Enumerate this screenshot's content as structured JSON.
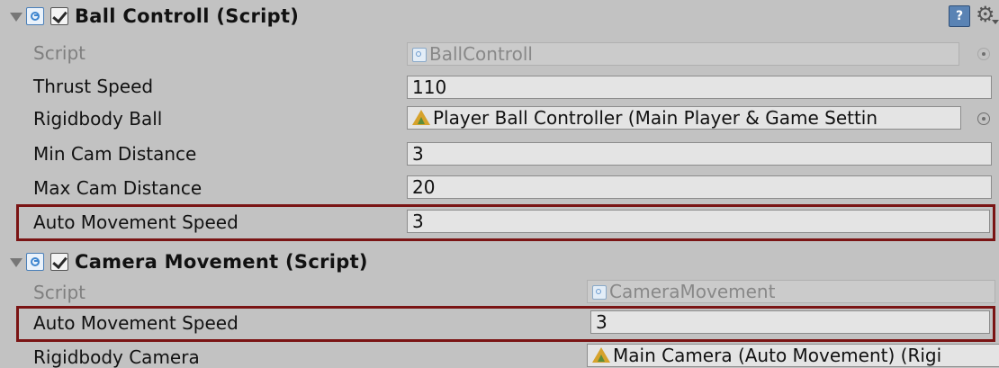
{
  "components": [
    {
      "title": "Ball Controll (Script)",
      "script_label": "Script",
      "script_value": "BallControll",
      "fields": [
        {
          "label": "Thrust Speed",
          "value": "110"
        },
        {
          "label": "Rigidbody Ball",
          "value": "Player Ball Controller (Main Player & Game Settin"
        },
        {
          "label": "Min Cam Distance",
          "value": "3"
        },
        {
          "label": "Max Cam Distance",
          "value": "20"
        },
        {
          "label": "Auto Movement Speed",
          "value": "3"
        }
      ]
    },
    {
      "title": "Camera Movement (Script)",
      "script_label": "Script",
      "script_value": "CameraMovement",
      "fields": [
        {
          "label": "Auto Movement Speed",
          "value": "3"
        },
        {
          "label": "Rigidbody Camera",
          "value": "Main Camera (Auto Movement) (Rigi"
        }
      ]
    }
  ],
  "header_icons": {
    "help": "?",
    "settings": "⚙"
  },
  "colors": {
    "highlight": "#7a1414",
    "panel": "#c2c2c2"
  }
}
